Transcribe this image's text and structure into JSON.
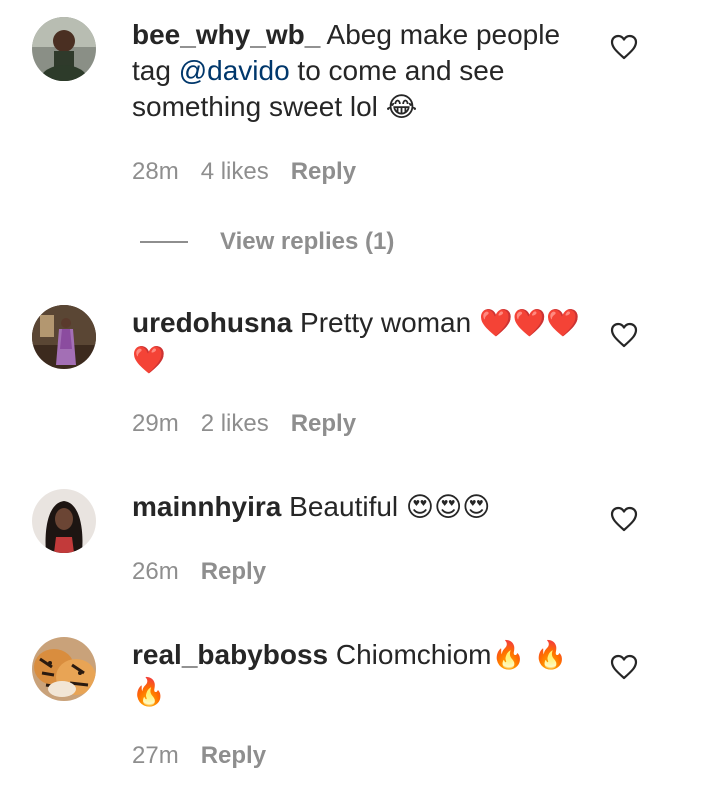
{
  "comments": [
    {
      "username": "bee_why_wb_",
      "text_before": "Abeg make people tag ",
      "mention": "@davido",
      "text_after": " to come and see something sweet lol ",
      "emoji": "😂",
      "time": "28m",
      "likes": "4 likes",
      "reply": "Reply",
      "avatar_icon": "person-avatar-icon"
    },
    {
      "username": "uredohusna",
      "text": "Pretty woman ",
      "emoji": "❤️❤️❤️ ❤️",
      "time": "29m",
      "likes": "2 likes",
      "reply": "Reply",
      "avatar_icon": "person-avatar-icon"
    },
    {
      "username": "mainnhyira",
      "text": "Beautiful ",
      "emoji": "😍😍😍",
      "time": "26m",
      "reply": "Reply",
      "avatar_icon": "person-avatar-icon"
    },
    {
      "username": "real_babyboss",
      "text": "Chiomchiom",
      "emoji": "🔥 🔥 🔥",
      "time": "27m",
      "reply": "Reply",
      "avatar_icon": "tiger-avatar-icon"
    }
  ],
  "view_replies": "View replies (1)",
  "colors": {
    "text": "#262626",
    "secondary": "#8e8e8e",
    "mention": "#00376b",
    "background": "#ffffff"
  }
}
